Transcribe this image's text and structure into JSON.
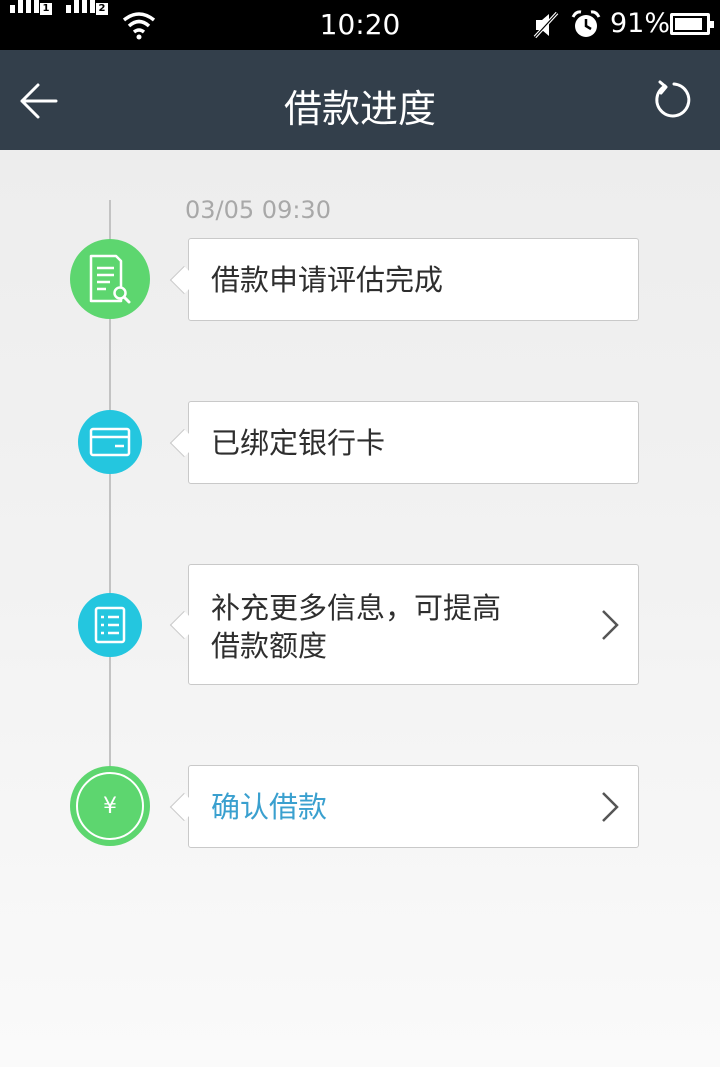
{
  "status_bar": {
    "sim1_label": "1",
    "sim2_label": "2",
    "time": "10:20",
    "battery_percent": "91%",
    "battery_level": 0.91
  },
  "navbar": {
    "back_icon": "arrow-left-icon",
    "title": "借款进度",
    "refresh_icon": "refresh-icon"
  },
  "timeline": {
    "timestamp": "03/05 09:30",
    "steps": [
      {
        "icon": "document-search-icon",
        "color": "#5dd66f",
        "label": "借款申请评估完成",
        "has_chevron": false
      },
      {
        "icon": "bank-card-icon",
        "color": "#24c6df",
        "label": "已绑定银行卡",
        "has_chevron": false
      },
      {
        "icon": "form-list-icon",
        "color": "#24c6df",
        "label_line1": "补充更多信息，可提高",
        "label_line2": "借款额度",
        "has_chevron": true
      },
      {
        "icon": "yuan-icon",
        "icon_char": "¥",
        "color": "#5dd66f",
        "label": "确认借款",
        "label_color": "#3aa0cf",
        "has_chevron": true
      }
    ]
  }
}
